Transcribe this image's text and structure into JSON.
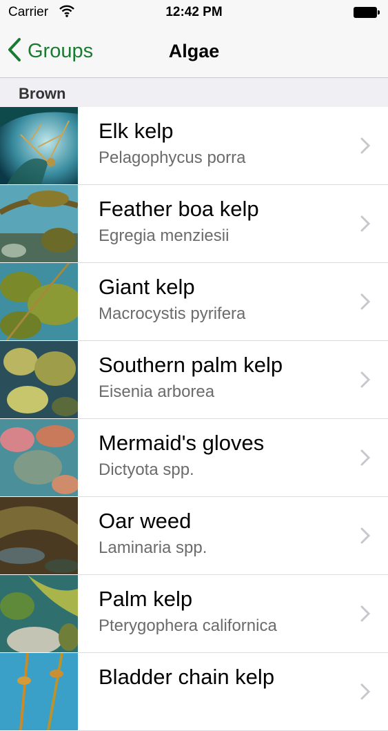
{
  "status_bar": {
    "carrier": "Carrier",
    "time": "12:42 PM",
    "icons": [
      "wifi-icon",
      "battery-icon"
    ]
  },
  "nav": {
    "back_label": "Groups",
    "title": "Algae",
    "back_icon": "chevron-left-icon",
    "accent": "#1b7a32"
  },
  "section": {
    "title": "Brown"
  },
  "items": [
    {
      "name": "Elk kelp",
      "scientific": "Pelagophycus porra"
    },
    {
      "name": "Feather boa kelp",
      "scientific": "Egregia menziesii"
    },
    {
      "name": "Giant kelp",
      "scientific": "Macrocystis pyrifera"
    },
    {
      "name": "Southern palm kelp",
      "scientific": "Eisenia arborea"
    },
    {
      "name": "Mermaid's gloves",
      "scientific": "Dictyota spp."
    },
    {
      "name": "Oar weed",
      "scientific": "Laminaria spp."
    },
    {
      "name": "Palm kelp",
      "scientific": "Pterygophera californica"
    },
    {
      "name": "Bladder chain kelp",
      "scientific": ""
    }
  ]
}
